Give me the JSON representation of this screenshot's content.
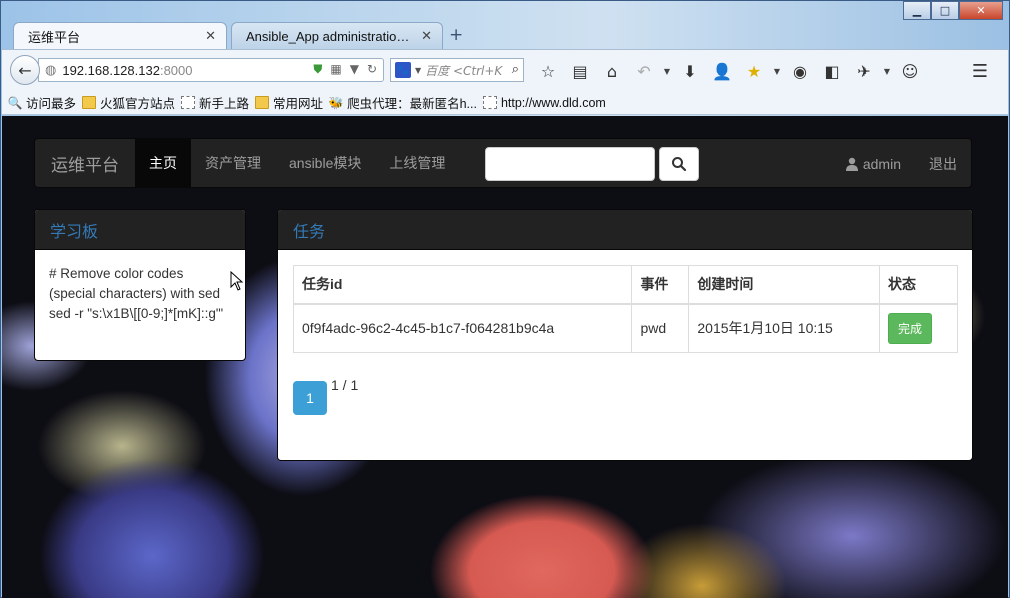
{
  "browser": {
    "window_controls": {
      "minimize": "▁",
      "maximize": "□",
      "close": "✕"
    },
    "tabs": [
      {
        "title": "运维平台",
        "close": "✕",
        "active": true
      },
      {
        "title": "Ansible_App administration ...",
        "close": "✕",
        "active": false
      }
    ],
    "new_tab": "+",
    "url": {
      "host": "192.168.128.132",
      "port": ":8000"
    },
    "search": {
      "placeholder": "百度 <Ctrl+K>"
    },
    "bookmarks": [
      {
        "label": "访问最多",
        "icon": "magnifier-icon"
      },
      {
        "label": "火狐官方站点",
        "icon": "folder-icon"
      },
      {
        "label": "新手上路",
        "icon": "page-icon"
      },
      {
        "label": "常用网址",
        "icon": "folder-icon"
      },
      {
        "label": "爬虫代理：最新匿名h...",
        "icon": "bee-icon"
      },
      {
        "label": "http://www.dld.com",
        "icon": "page-icon"
      }
    ]
  },
  "app": {
    "brand": "运维平台",
    "nav": [
      {
        "label": "主页",
        "active": true
      },
      {
        "label": "资产管理",
        "active": false
      },
      {
        "label": "ansible模块",
        "active": false
      },
      {
        "label": "上线管理",
        "active": false
      }
    ],
    "user": "admin",
    "logout": "退出"
  },
  "learn_panel": {
    "title": "学习板",
    "content": "# Remove color codes (special characters) with sed sed -r \"s:\\x1B\\[[0-9;]*[mK]::g\"'"
  },
  "task_panel": {
    "title": "任务",
    "columns": [
      "任务id",
      "事件",
      "创建时间",
      "状态"
    ],
    "rows": [
      {
        "id": "0f9f4adc-96c2-4c45-b1c7-f064281b9c4a",
        "event": "pwd",
        "created": "2015年1月10日 10:15",
        "status": "完成"
      }
    ],
    "pagination": {
      "current": "1",
      "info": "1 / 1"
    }
  },
  "colors": {
    "navbar_bg": "#222222",
    "panel_title": "#337ab7",
    "status_success": "#5cb85c",
    "page_active": "#3ca0d6"
  }
}
